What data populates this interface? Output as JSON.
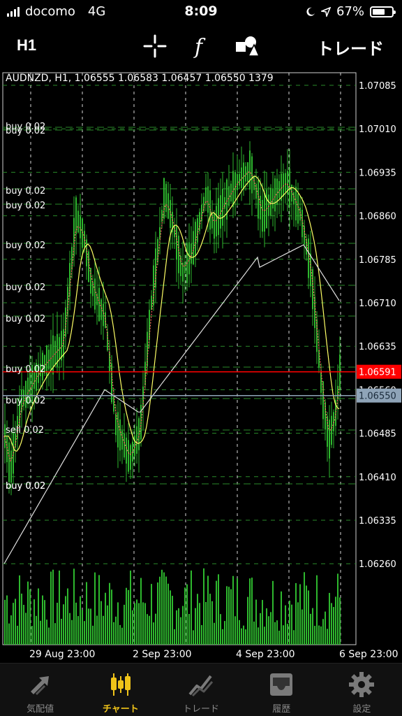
{
  "status_bar": {
    "carrier": "docomo",
    "network": "4G",
    "time": "8:09",
    "battery": "67%",
    "battery_level": 0.67
  },
  "toolbar": {
    "timeframe": "H1",
    "crosshair_icon": "crosshair-icon",
    "indicators_icon": "function-icon",
    "objects_icon": "shapes-icon",
    "trade_label": "トレード"
  },
  "chart": {
    "symbol_info": "AUDNZD, H1, 1.06555 1.06583 1.06457 1.06550 1379",
    "colors": {
      "background": "#000000",
      "candles": "#2eb82e",
      "volume": "#2eb82e",
      "ma_fast": "#ffff66",
      "ma_slow": "#e0e0e0",
      "ma_dotted": "#ff6060",
      "bid_line": "#ff0000",
      "sell_line": "#8fa4b8",
      "grid": "#2a8a2a"
    },
    "price_scale": [
      "1.07085",
      "1.07010",
      "1.06935",
      "1.06860",
      "1.06785",
      "1.06710",
      "1.06635",
      "1.06560",
      "1.06485",
      "1.06410",
      "1.06335",
      "1.06260"
    ],
    "current_bid": "1.06591",
    "current_sell": "1.06550",
    "time_labels": [
      "29 Aug 23:00",
      "2 Sep 23:00",
      "4 Sep 23:00",
      "6 Sep 23:00"
    ],
    "orders": [
      {
        "label": "buy 0.02"
      },
      {
        "label": "buy 0.02"
      },
      {
        "label": "buy 0.02"
      },
      {
        "label": "buy 0.02"
      },
      {
        "label": "buy 0.02"
      },
      {
        "label": "buy 0.02"
      },
      {
        "label": "buy 0.02"
      },
      {
        "label": "buy 0.02"
      },
      {
        "label": "buy 0.02"
      },
      {
        "label": "sell 0.02"
      },
      {
        "label": "buy 0.02"
      },
      {
        "label": "buy 0.02"
      }
    ]
  },
  "tabs": [
    {
      "label": "気配値",
      "icon": "quotes-arrows-icon",
      "active": false
    },
    {
      "label": "チャート",
      "icon": "candles-icon",
      "active": true
    },
    {
      "label": "トレード",
      "icon": "trade-line-icon",
      "active": false
    },
    {
      "label": "履歴",
      "icon": "inbox-icon",
      "active": false
    },
    {
      "label": "設定",
      "icon": "gear-icon",
      "active": false
    }
  ]
}
